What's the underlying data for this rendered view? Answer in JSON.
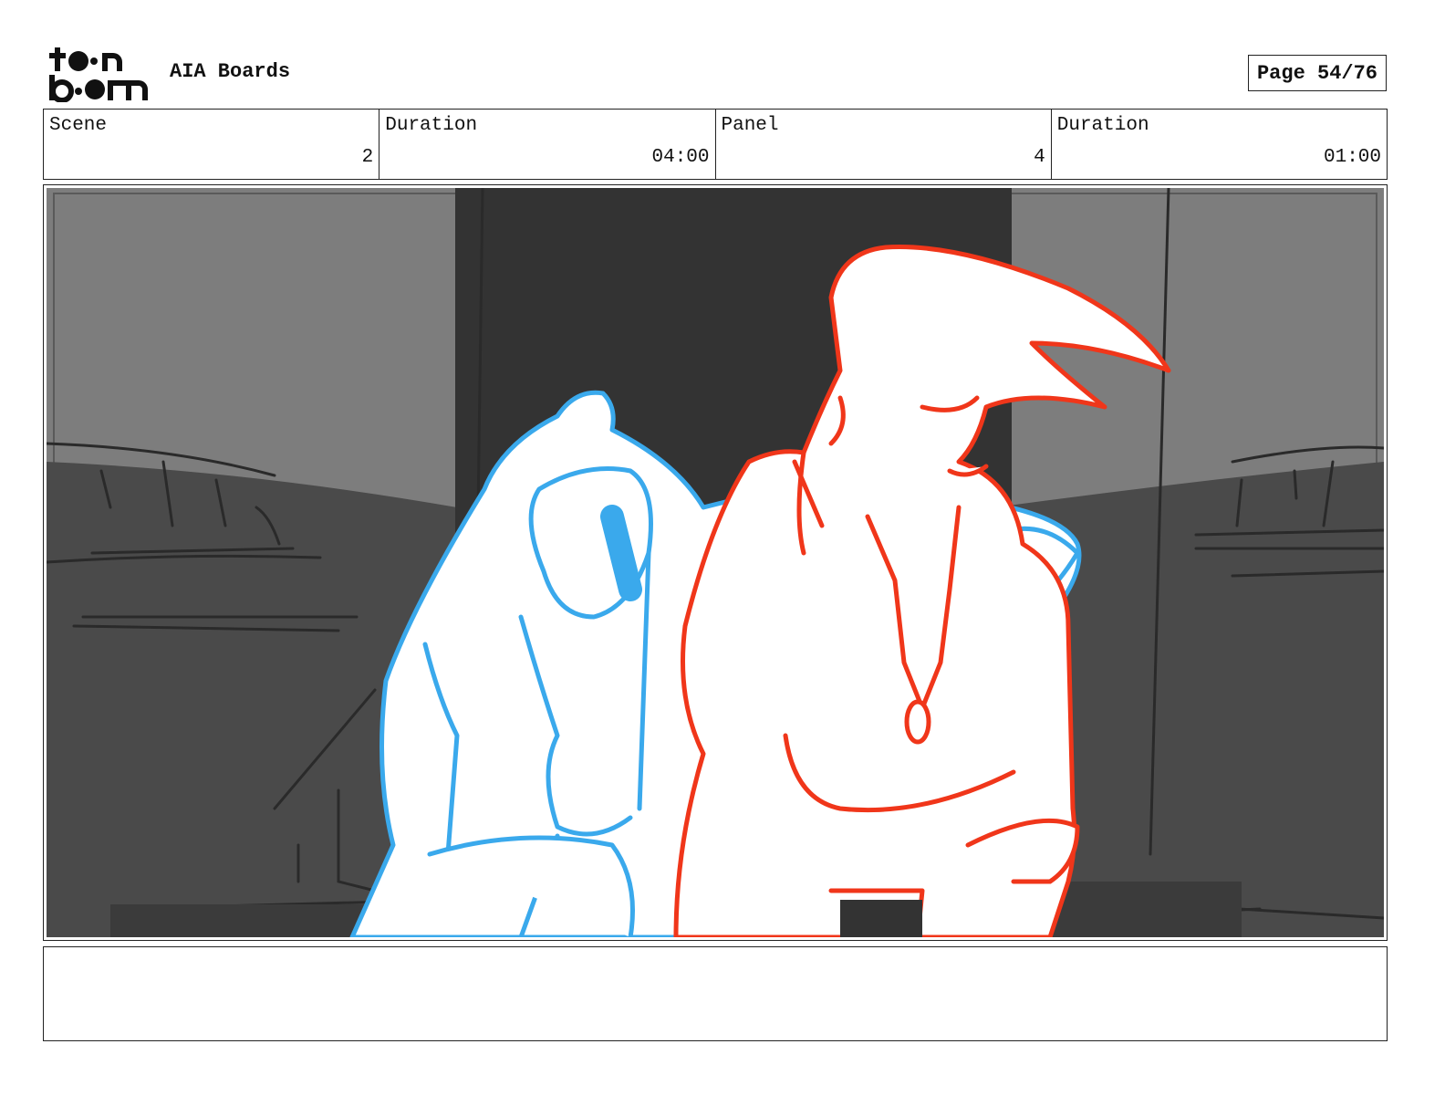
{
  "header": {
    "logo_text": "toon boom",
    "project_title": "AIA Boards",
    "page_label": "Page 54/76"
  },
  "info": {
    "scene_label": "Scene",
    "scene_value": "2",
    "scene_duration_label": "Duration",
    "scene_duration_value": "04:00",
    "panel_label": "Panel",
    "panel_value": "4",
    "panel_duration_label": "Duration",
    "panel_duration_value": "01:00"
  },
  "panel": {
    "colors": {
      "left_character_line": "#3aa9ec",
      "right_character_line": "#f0361a",
      "background_light": "#7d7d7d",
      "background_dark": "#4a4a4a",
      "doorway": "#333333"
    }
  },
  "notes": {
    "text": ""
  }
}
